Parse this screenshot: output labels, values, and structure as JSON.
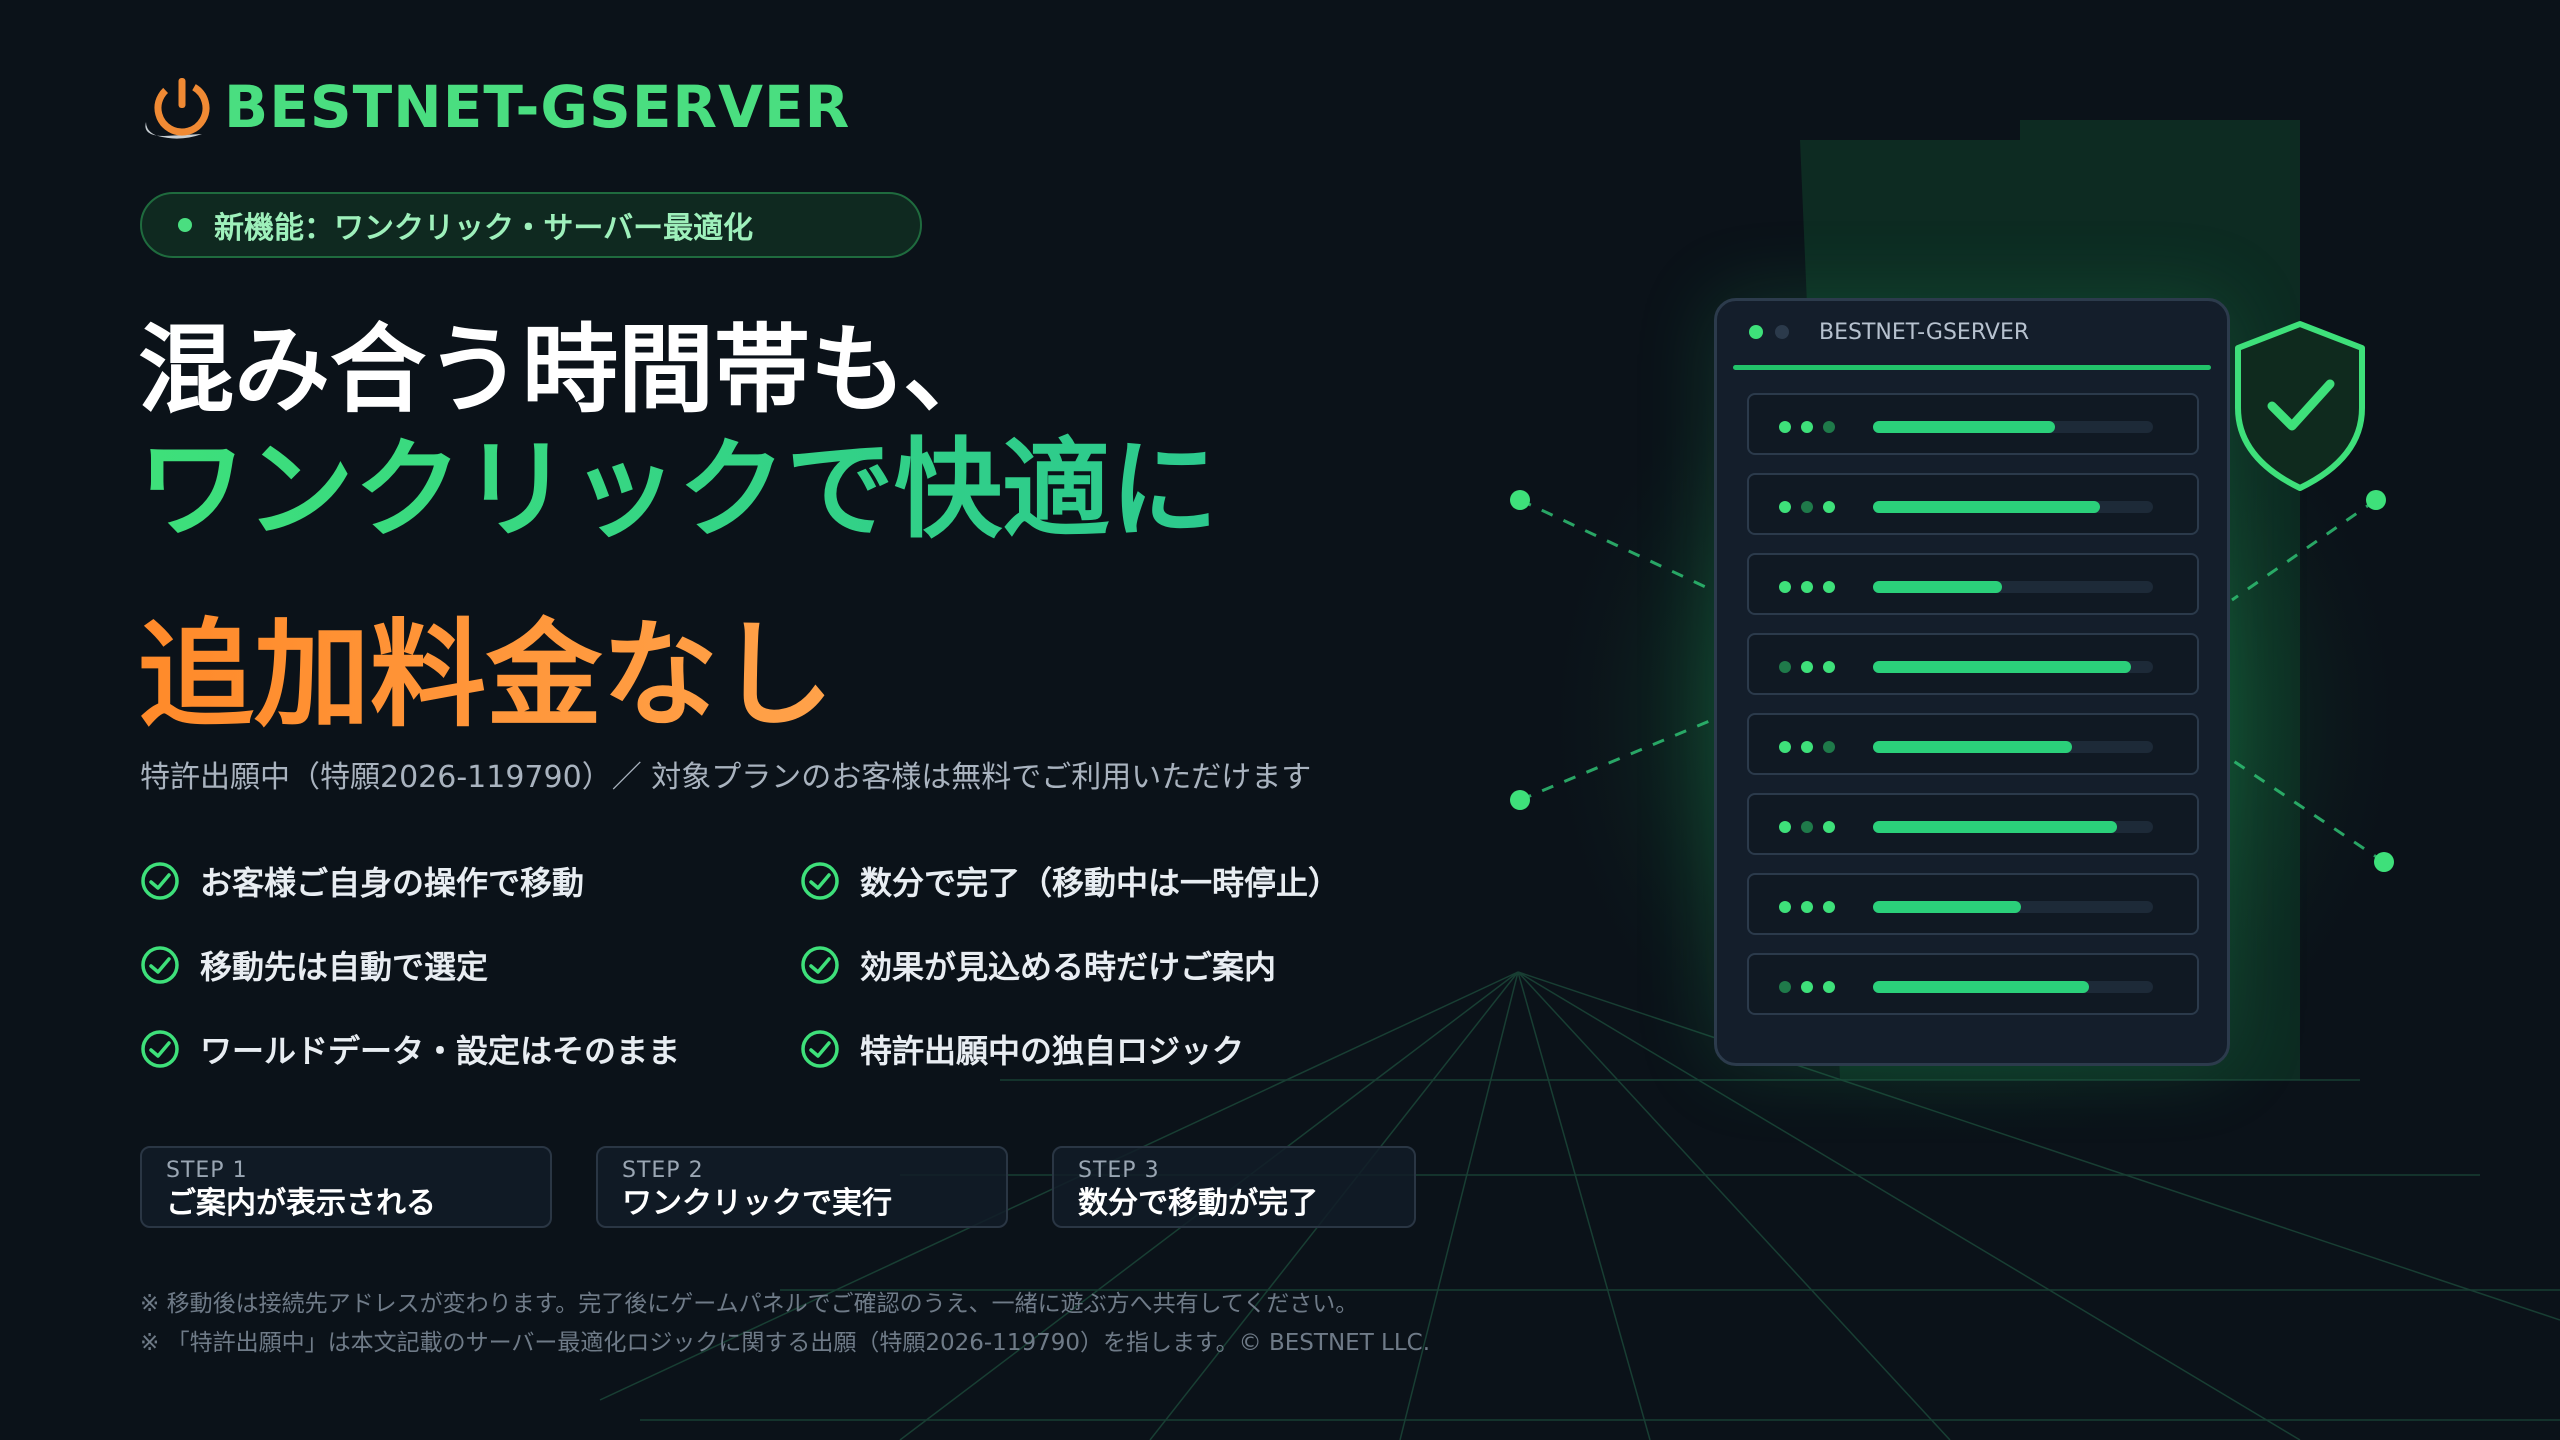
{
  "brand": {
    "name": "BESTNET-GSERVER",
    "accent": "#4ade80",
    "orange": "#ff8a2a"
  },
  "badge": {
    "text": "新機能：ワンクリック・サーバー最適化"
  },
  "headline": {
    "line1": "混み合う時間帯も、",
    "line2": "ワンクリックで快適に",
    "line3": "追加料金なし"
  },
  "subtext": "特許出願中（特願2026-119790）／ 対象プランのお客様は無料でご利用いただけます",
  "features": [
    {
      "text": "お客様ご自身の操作で移動",
      "icon": "check-circle-icon"
    },
    {
      "text": "数分で完了（移動中は一時停止）",
      "icon": "check-circle-icon"
    },
    {
      "text": "移動先は自動で選定",
      "icon": "check-circle-icon"
    },
    {
      "text": "効果が見込める時だけご案内",
      "icon": "check-circle-icon"
    },
    {
      "text": "ワールドデータ・設定はそのまま",
      "icon": "check-circle-icon"
    },
    {
      "text": "特許出願中の独自ロジック",
      "icon": "check-circle-icon"
    }
  ],
  "steps": [
    {
      "label": "STEP 1",
      "text": "ご案内が表示される"
    },
    {
      "label": "STEP 2",
      "text": "ワンクリックで実行"
    },
    {
      "label": "STEP 3",
      "text": "数分で移動が完了"
    }
  ],
  "notes": [
    "※ 移動後は接続先アドレスが変わります。完了後にゲームパネルでご確認のうえ、一緒に遊ぶ方へ共有してください。",
    "※ 「特許出願中」は本文記載のサーバー最適化ロジックに関する出願（特願2026-119790）を指します。© BESTNET LLC."
  ],
  "panel": {
    "title": "BESTNET-GSERVER",
    "racks": [
      {
        "load": 0.65
      },
      {
        "load": 0.81
      },
      {
        "load": 0.46
      },
      {
        "load": 0.92
      },
      {
        "load": 0.71
      },
      {
        "load": 0.87
      },
      {
        "load": 0.53
      },
      {
        "load": 0.77
      }
    ]
  }
}
